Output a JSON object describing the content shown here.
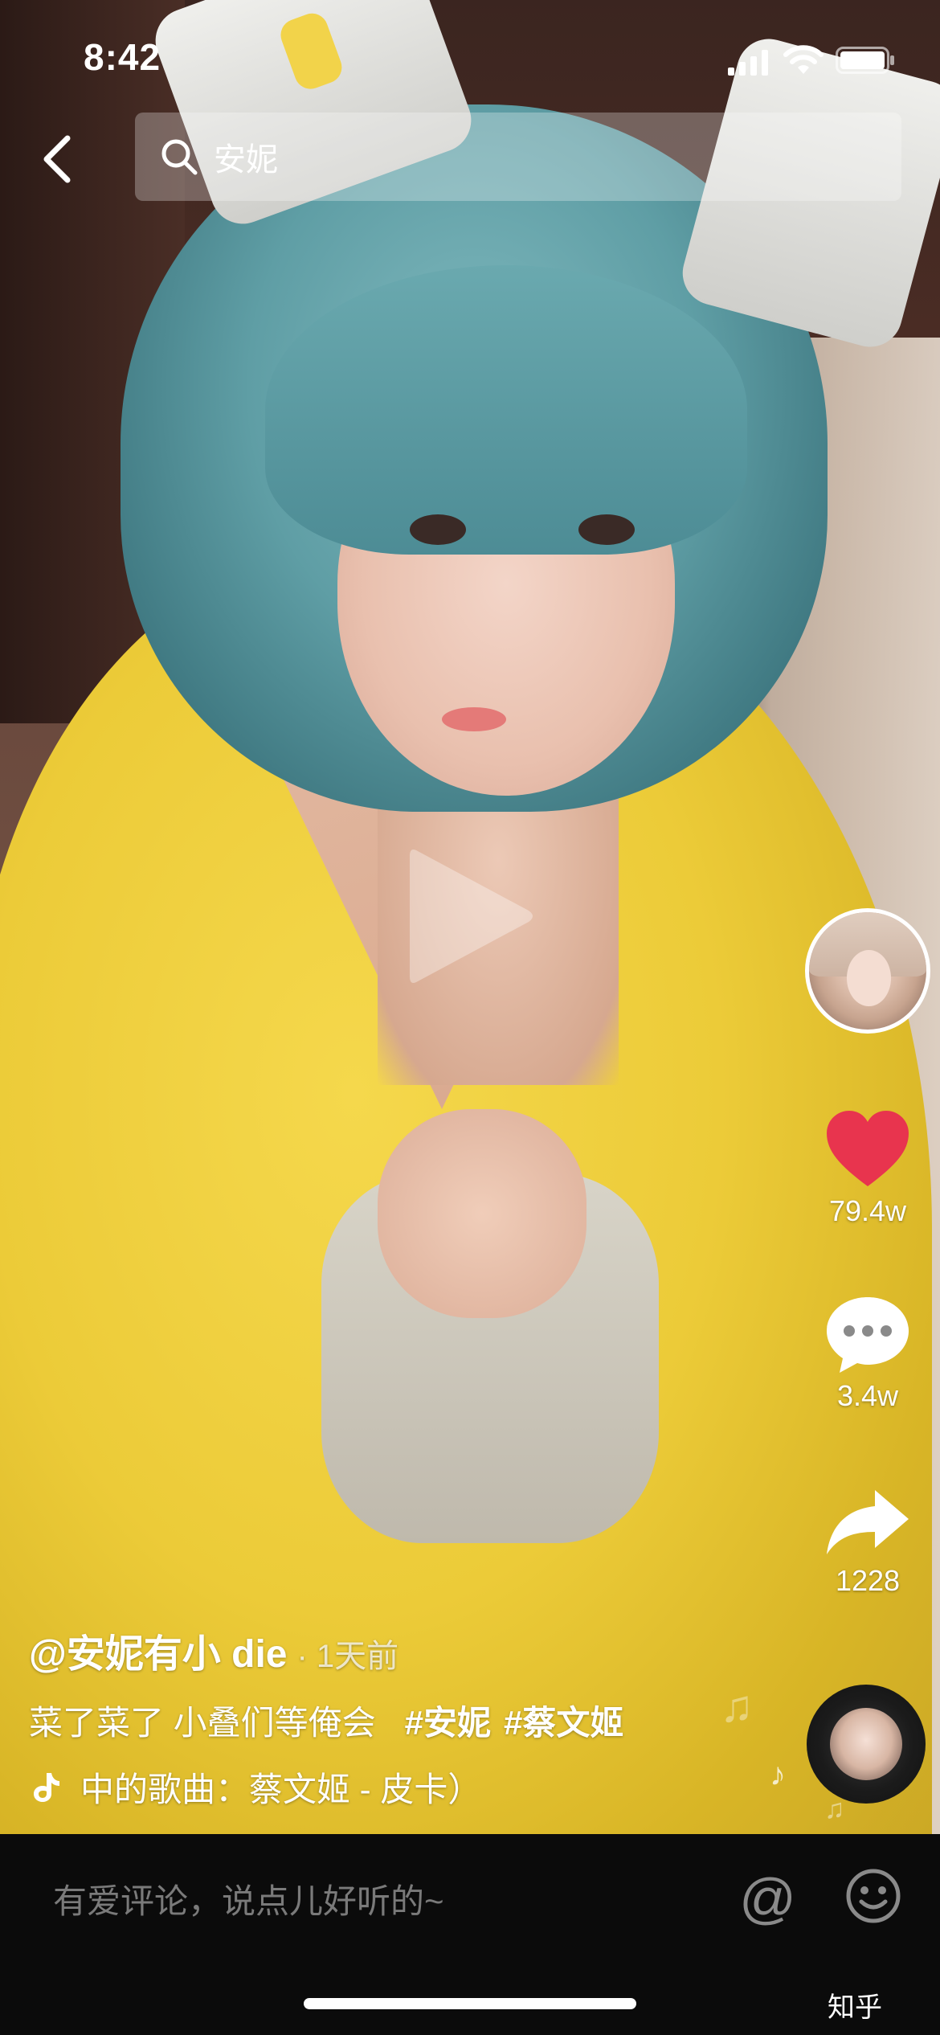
{
  "status_bar": {
    "time": "8:42"
  },
  "search": {
    "query": "安妮"
  },
  "post": {
    "author": "@安妮有小 die",
    "time": "· 1天前",
    "description": "菜了菜了 小叠们等俺会",
    "hashtags": [
      "#安妮",
      "#蔡文姬"
    ],
    "music": "中的歌曲：蔡文姬 - 皮卡）"
  },
  "actions": {
    "likes": "79.4w",
    "comments": "3.4w",
    "shares": "1228"
  },
  "comment_bar": {
    "placeholder": "有爱评论，说点儿好听的~",
    "at_symbol": "@"
  },
  "watermark": "知乎",
  "colors": {
    "like": "#e8344e",
    "robe": "#eccb38",
    "hair": "#5f9ea5"
  }
}
